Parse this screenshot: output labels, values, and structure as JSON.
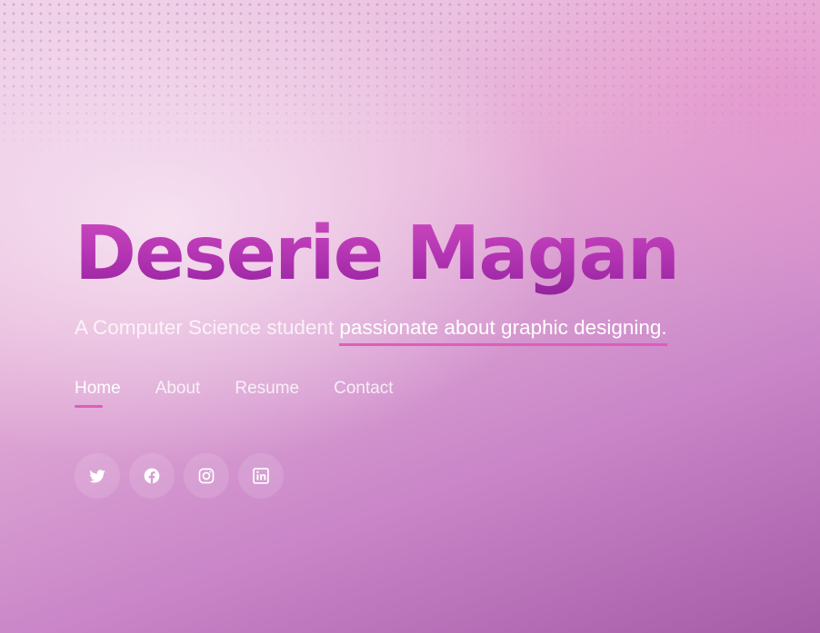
{
  "hero": {
    "name": "Deserie Magan",
    "tagline_prefix": "A Computer Science student ",
    "tagline_highlight": "passionate about graphic designing."
  },
  "nav": {
    "items": [
      {
        "label": "Home",
        "active": true
      },
      {
        "label": "About",
        "active": false
      },
      {
        "label": "Resume",
        "active": false
      },
      {
        "label": "Contact",
        "active": false
      }
    ]
  },
  "socials": [
    {
      "icon": "twitter-icon"
    },
    {
      "icon": "facebook-icon"
    },
    {
      "icon": "instagram-icon"
    },
    {
      "icon": "linkedin-icon"
    }
  ],
  "colors": {
    "accent": "#e05cba",
    "name_gradient_top": "#d04ec2",
    "name_gradient_bottom": "#8f1f9c"
  }
}
